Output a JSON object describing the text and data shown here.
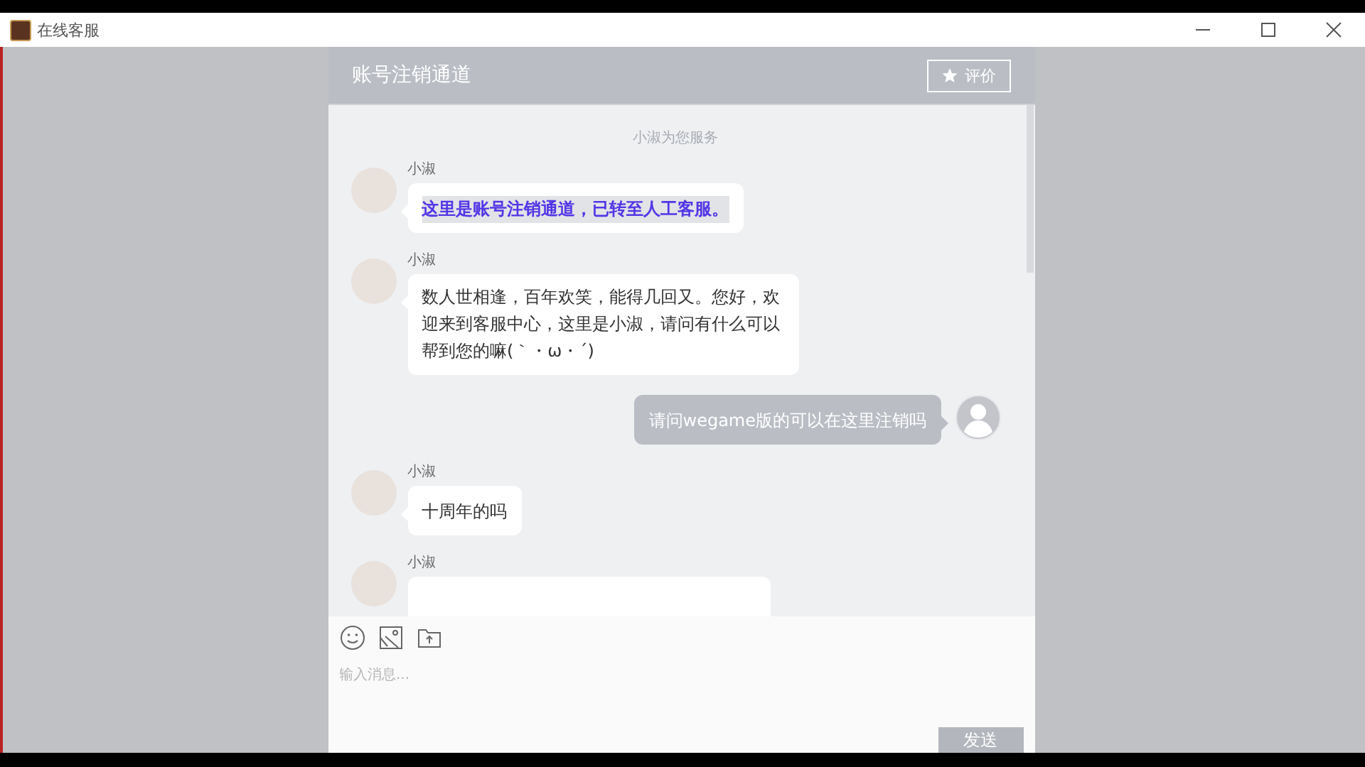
{
  "window": {
    "title": "在线客服"
  },
  "chat": {
    "title": "账号注销通道",
    "rate_button": "评价",
    "notice": "小淑为您服务",
    "messages": [
      {
        "kind": "agent",
        "sender": "小淑",
        "text": "这里是账号注销通道，已转至人工客服。",
        "highlighted": true
      },
      {
        "kind": "agent",
        "sender": "小淑",
        "text": "数人世相逢，百年欢笑，能得几回又。您好，欢迎来到客服中心，这里是小淑，请问有什么可以帮到您的嘛(｀・ω・´)",
        "highlighted": false
      },
      {
        "kind": "user",
        "text": "请问wegame版的可以在这里注销吗",
        "highlighted": false
      },
      {
        "kind": "agent",
        "sender": "小淑",
        "text": "十周年的吗",
        "highlighted": false
      },
      {
        "kind": "agent",
        "sender": "小淑",
        "highlighted": false
      }
    ]
  },
  "composer": {
    "placeholder": "输入消息...",
    "send_button": "发送"
  }
}
